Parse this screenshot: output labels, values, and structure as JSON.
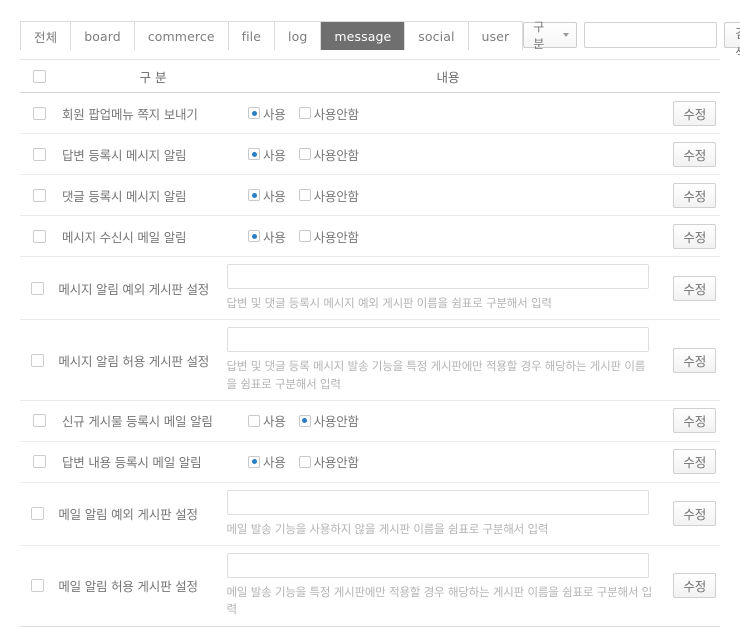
{
  "tabs": [
    {
      "label": "전체",
      "active": false
    },
    {
      "label": "board",
      "active": false
    },
    {
      "label": "commerce",
      "active": false
    },
    {
      "label": "file",
      "active": false
    },
    {
      "label": "log",
      "active": false
    },
    {
      "label": "message",
      "active": true
    },
    {
      "label": "social",
      "active": false
    },
    {
      "label": "user",
      "active": false
    }
  ],
  "search": {
    "select_label": "구 분",
    "input_value": "",
    "input_placeholder": "",
    "button_label": "검색"
  },
  "table": {
    "headers": {
      "gubun": "구 분",
      "naeyong": "내용"
    },
    "radio_labels": {
      "on": "사용",
      "off": "사용안함"
    },
    "edit_label": "수정",
    "rows": [
      {
        "label": "회원 팝업메뉴 쪽지 보내기",
        "type": "radio",
        "selected": "on",
        "helper": ""
      },
      {
        "label": "답변 등록시 메시지 알림",
        "type": "radio",
        "selected": "on",
        "helper": ""
      },
      {
        "label": "댓글 등록시 메시지 알림",
        "type": "radio",
        "selected": "on",
        "helper": ""
      },
      {
        "label": "메시지 수신시 메일 알림",
        "type": "radio",
        "selected": "on",
        "helper": ""
      },
      {
        "label": "메시지 알림 예외 게시판 설정",
        "type": "text",
        "value": "",
        "helper": "답변 및 댓글 등록시 메시지 예외 게시판 이름을 쉼표로 구분해서 입력"
      },
      {
        "label": "메시지 알림 허용 게시판 설정",
        "type": "text",
        "value": "",
        "helper": "답변 및 댓글 등록 메시지 발송 기능을 특정 게시판에만 적용할 경우 해당하는 게시판 이름을 쉼표로 구분해서 입력"
      },
      {
        "label": "신규 게시물 등록시 메일 알림",
        "type": "radio",
        "selected": "off",
        "helper": ""
      },
      {
        "label": "답변 내용 등록시 메일 알림",
        "type": "radio",
        "selected": "on",
        "helper": ""
      },
      {
        "label": "메일 알림 예외 게시판 설정",
        "type": "text",
        "value": "",
        "helper": "메일 발송 기능을 사용하지 않을 게시판 이름을 쉼표로 구분해서 입력"
      },
      {
        "label": "메일 알림 허용 게시판 설정",
        "type": "text",
        "value": "",
        "helper": "메일 발송 기능을 특정 게시판에만 적용할 경우 해당하는 게시판 이름을 쉼표로 구분해서 입력"
      }
    ]
  },
  "colors": {
    "accent": "#2a7ec4",
    "active_tab_bg": "#6f6f6f",
    "text": "#777777",
    "helper_text": "#b4b4b4",
    "border": "#dddddd"
  }
}
